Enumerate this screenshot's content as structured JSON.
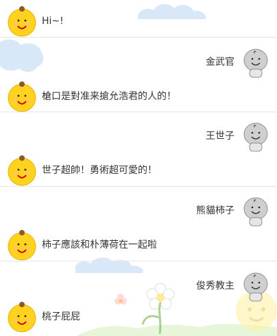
{
  "chat": {
    "messages": [
      {
        "side": "left",
        "avatar": "yellow-bun-avatar",
        "text": "Hi~!"
      },
      {
        "side": "right",
        "avatar": "gray-doodle-avatar",
        "text": "金武官"
      },
      {
        "side": "left",
        "avatar": "yellow-bun-avatar",
        "text": "槍口是對准来搶允浩君的人的！"
      },
      {
        "side": "right",
        "avatar": "gray-doodle-avatar",
        "text": "王世子"
      },
      {
        "side": "left",
        "avatar": "yellow-bun-avatar",
        "text": "世子超帥！勇術超可愛的！"
      },
      {
        "side": "right",
        "avatar": "gray-doodle-avatar",
        "text": "熊貓柿子"
      },
      {
        "side": "left",
        "avatar": "yellow-bun-avatar",
        "text": "柿子應該和朴薄荷在一起啦"
      },
      {
        "side": "right",
        "avatar": "gray-doodle-avatar",
        "text": "俊秀教主"
      },
      {
        "side": "left",
        "avatar": "yellow-bun-avatar",
        "text": "桃子屁屁"
      }
    ]
  },
  "colors": {
    "yellow_avatar": "#ffd21f",
    "gray_avatar": "#cfcfcf",
    "cloud": "#d8e8f8",
    "divider": "#e6e6e6",
    "text": "#333333"
  }
}
